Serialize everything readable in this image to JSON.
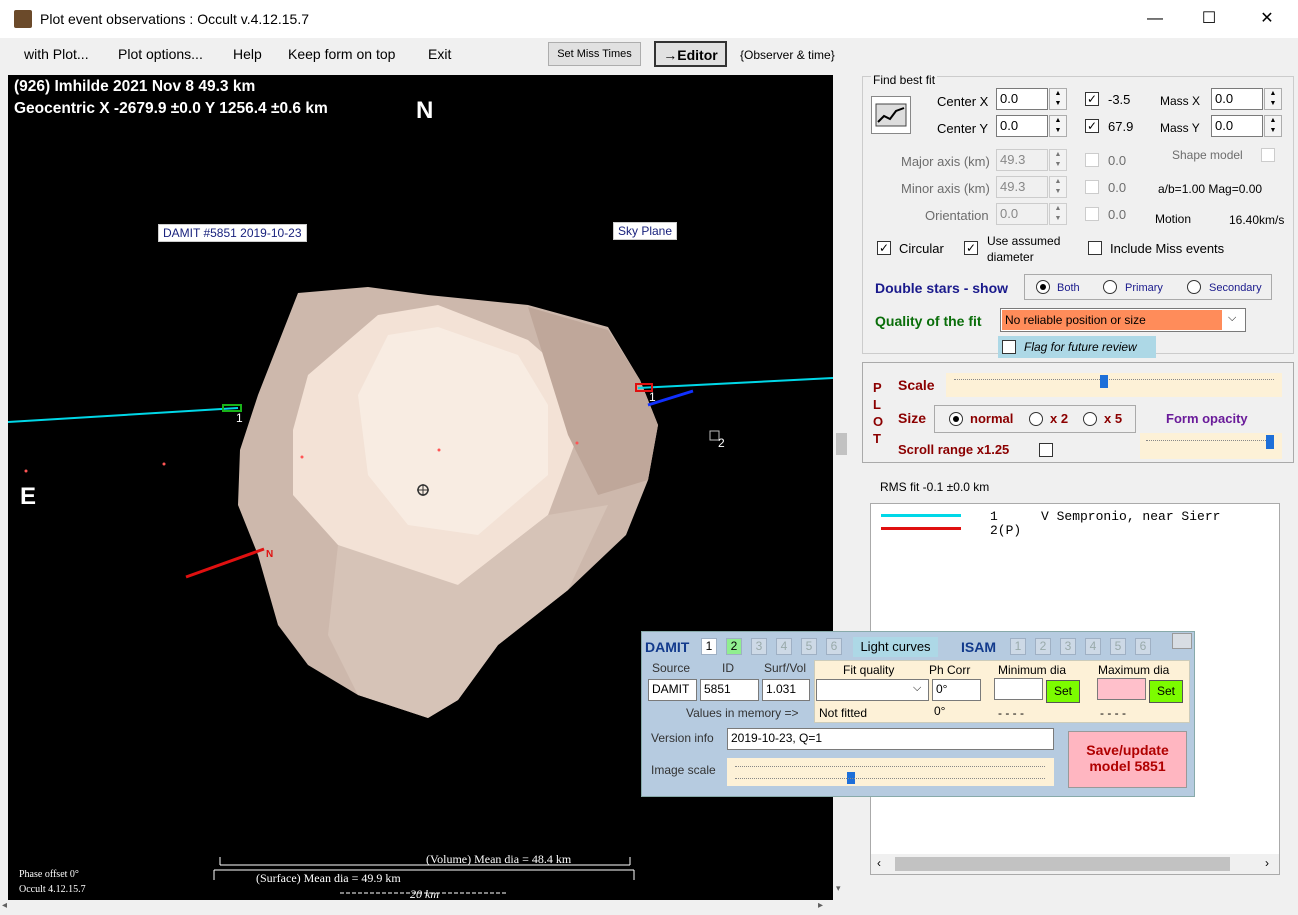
{
  "window": {
    "title": "Plot event observations : Occult v.4.12.15.7",
    "minimize": "—",
    "maximize": "☐",
    "close": "✕"
  },
  "menu": {
    "items": [
      "with Plot...",
      "Plot options...",
      "Help",
      "Keep form on top",
      "Exit"
    ],
    "set_miss_times": "Set Miss Times",
    "editor": "→Editor",
    "observer_time": "{Observer & time}"
  },
  "plot": {
    "title_line1": "(926) Imhilde  2021 Nov 8  49.3 km",
    "title_line2": "Geocentric X -2679.9 ±0.0  Y 1256.4 ±0.6 km",
    "north": "N",
    "east": "E",
    "damit_label": "DAMIT #5851 2019-10-23",
    "sky_plane": "Sky Plane",
    "chord1_left": "1",
    "chord1_right": "1",
    "chord2": "2",
    "n_marker": "N",
    "volume_dia": "(Volume) Mean dia = 48.4 km",
    "surface_dia": "(Surface) Mean dia = 49.9 km",
    "scale_bar": "20 km",
    "phase_offset": "Phase offset 0°",
    "version": "Occult 4.12.15.7",
    "colors": {
      "chord1": "#00d8e8",
      "chord2": "#e01010",
      "shape": "#e8d8cc"
    }
  },
  "fit": {
    "title": "Find best fit",
    "center_x_label": "Center X",
    "center_x": "0.0",
    "center_y_label": "Center Y",
    "center_y": "0.0",
    "cx_check_val": "-3.5",
    "cy_check_val": "67.9",
    "mass_x_label": "Mass X",
    "mass_x": "0.0",
    "mass_y_label": "Mass Y",
    "mass_y": "0.0",
    "major_label": "Major axis (km)",
    "major": "49.3",
    "major_chk": "0.0",
    "minor_label": "Minor axis (km)",
    "minor": "49.3",
    "minor_chk": "0.0",
    "orient_label": "Orientation",
    "orient": "0.0",
    "orient_chk": "0.0",
    "shape_model": "Shape model",
    "ab_mag": "a/b=1.00  Mag=0.00",
    "motion_label": "Motion",
    "motion": "16.40km/s",
    "circular": "Circular",
    "use_assumed": "Use assumed",
    "diameter": "diameter",
    "include_miss": "Include Miss events"
  },
  "double_stars": {
    "label": "Double stars - show",
    "both": "Both",
    "primary": "Primary",
    "secondary": "Secondary"
  },
  "quality": {
    "label": "Quality of the fit",
    "value": "No reliable position or size",
    "flag": "Flag for future review",
    "color": "#ff8c5a"
  },
  "plotctl": {
    "letters": [
      "P",
      "L",
      "O",
      "T"
    ],
    "scale": "Scale",
    "size": "Size",
    "normal": "normal",
    "x2": "x 2",
    "x5": "x 5",
    "form_opacity": "Form opacity",
    "scroll_range": "Scroll range x1.25"
  },
  "rms": "RMS fit -0.1 ±0.0 km",
  "legend": {
    "row1_num": "1",
    "row1_text": "V Sempronio, near Sierr",
    "row2": "2(P)"
  },
  "damit": {
    "title": "DAMIT",
    "nums": [
      "1",
      "2",
      "3",
      "4",
      "5",
      "6"
    ],
    "light_curves": "Light curves",
    "isam": "ISAM",
    "isam_nums": [
      "1",
      "2",
      "3",
      "4",
      "5",
      "6"
    ],
    "source_label": "Source",
    "id_label": "ID",
    "surfvol_label": "Surf/Vol",
    "source": "DAMIT",
    "id": "5851",
    "surfvol": "1.031",
    "fit_quality": "Fit quality",
    "ph_corr": "Ph Corr",
    "ph_corr_val": "0°",
    "min_dia": "Minimum dia",
    "max_dia": "Maximum dia",
    "set": "Set",
    "values_mem": "Values in memory =>",
    "not_fitted": "Not fitted",
    "ph_mem": "0°",
    "dashes": "- - - -",
    "version_label": "Version info",
    "version": "2019-10-23, Q=1",
    "image_scale": "Image scale",
    "save": "Save/update",
    "save2": "model 5851"
  }
}
